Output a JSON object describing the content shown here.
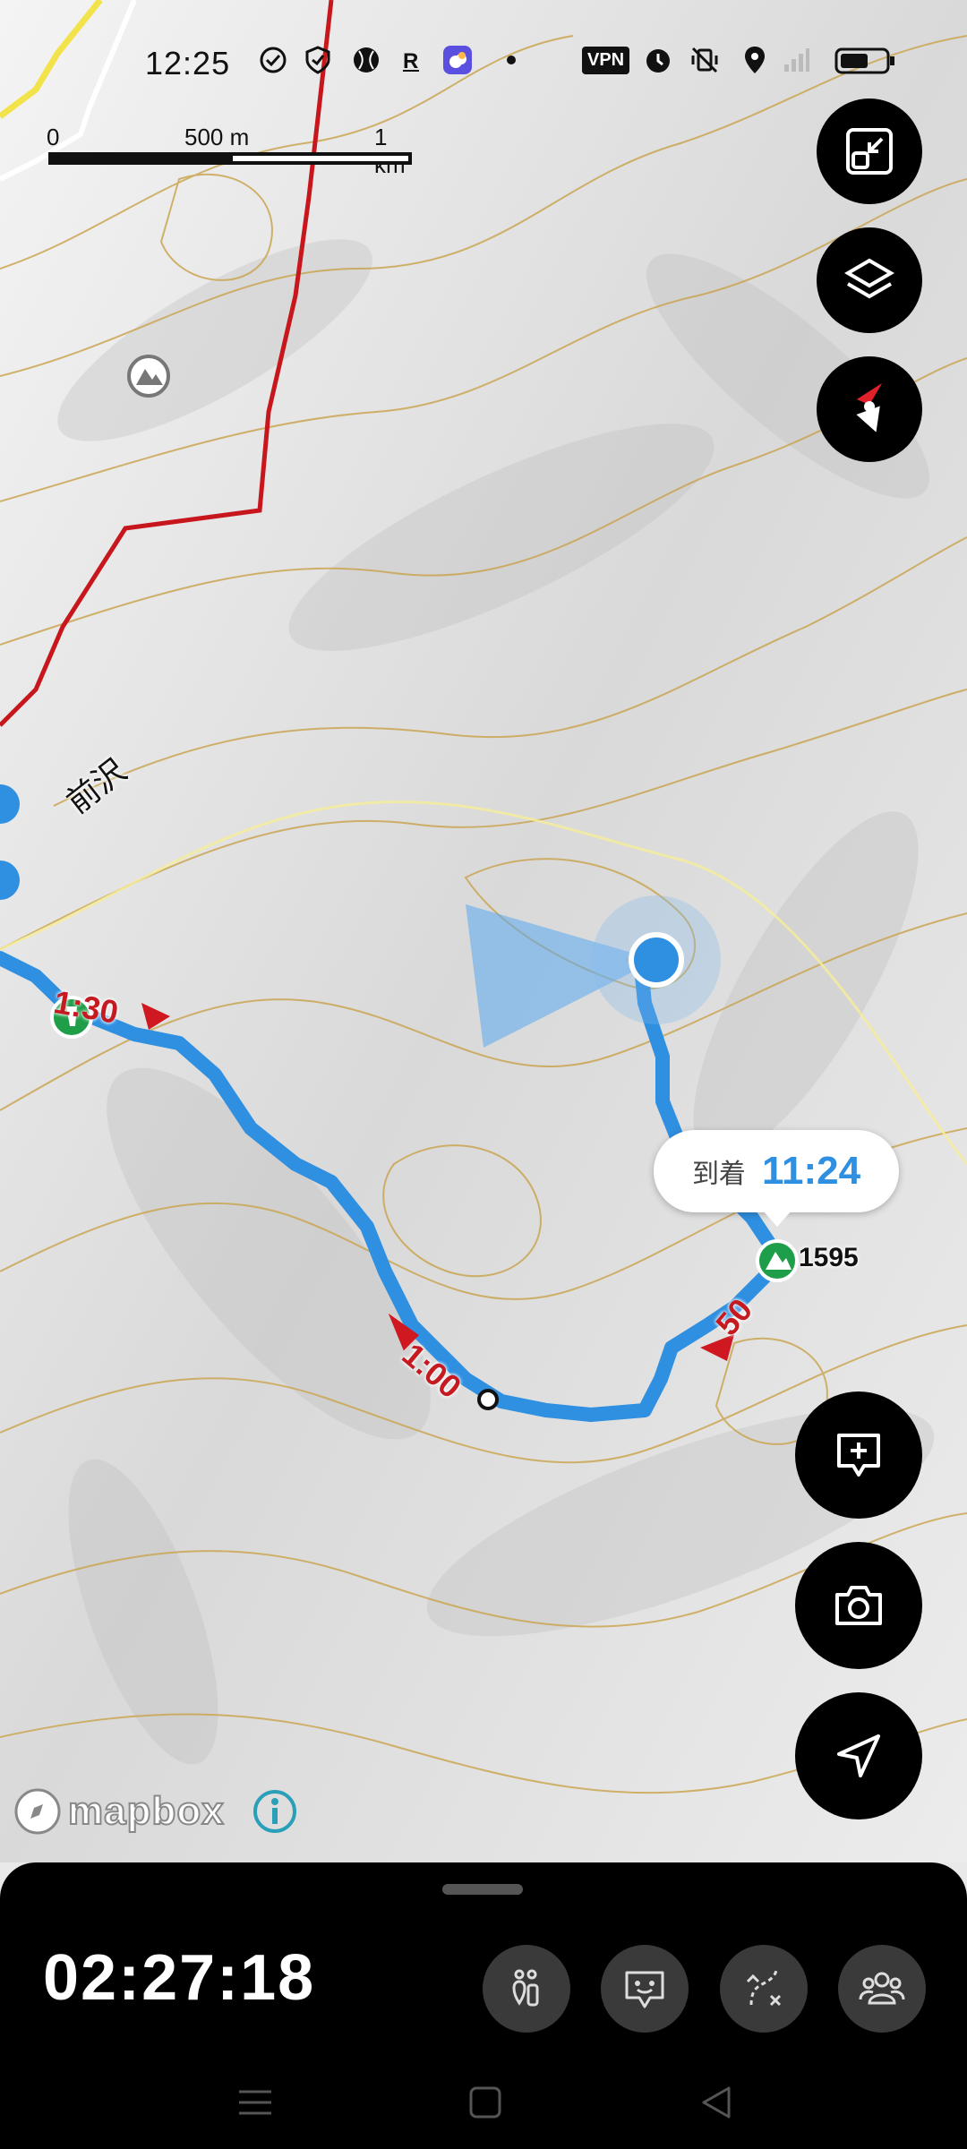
{
  "status_bar": {
    "time": "12:25",
    "vpn_label": "VPN",
    "icons": [
      "check-circle-icon",
      "shield-check-icon",
      "baseball-icon",
      "r-icon",
      "weather-app-icon",
      "dot-icon",
      "vpn-icon",
      "alarm-icon",
      "vibrate-off-icon",
      "location-icon",
      "signal-icon",
      "battery-icon"
    ]
  },
  "scale_bar": {
    "zero": "0",
    "mid": "500 m",
    "end": "1 km"
  },
  "map": {
    "place_name": "前沢",
    "arrival_label": "到着",
    "arrival_time": "11:24",
    "summit_elevation": "1595",
    "time_markers": [
      "1:30",
      "1:00",
      "50"
    ],
    "attribution": "mapbox",
    "colors": {
      "route": "#2f8fe0",
      "contour": "#c9a24a",
      "trail_red": "#c8161d",
      "marker_red": "#d01820"
    }
  },
  "map_controls": {
    "top": [
      "fit-route-icon",
      "layers-icon",
      "compass-icon"
    ],
    "bottom": [
      "add-memo-icon",
      "camera-icon",
      "navigate-icon"
    ]
  },
  "bottom_panel": {
    "elapsed_time": "02:27:18",
    "tools": [
      "checkpoint-list-icon",
      "chat-icon",
      "route-off-icon",
      "group-icon"
    ]
  },
  "system_nav": [
    "menu-icon",
    "home-icon",
    "back-icon"
  ]
}
